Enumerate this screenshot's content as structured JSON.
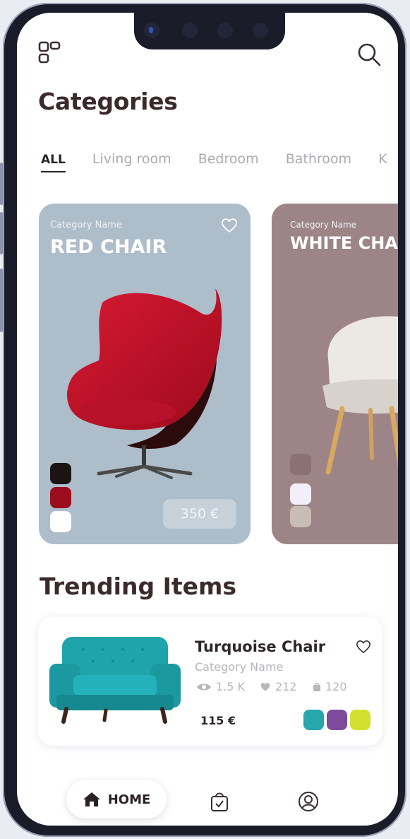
{
  "page": {
    "title": "Categories",
    "trending_title": "Trending Items"
  },
  "tabs": [
    {
      "label": "ALL",
      "active": true
    },
    {
      "label": "Living room",
      "active": false
    },
    {
      "label": "Bedroom",
      "active": false
    },
    {
      "label": "Bathroom",
      "active": false
    },
    {
      "label": "K",
      "active": false
    }
  ],
  "cards": [
    {
      "subtitle": "Category Name",
      "name": "RED CHAIR",
      "price": "350 €",
      "background": "#aebdca",
      "swatches": [
        "#1c1414",
        "#9b0d1d",
        "#ffffff"
      ]
    },
    {
      "subtitle": "Category Name",
      "name": "WHITE CHAI",
      "background": "#9d8587",
      "swatches": [
        "#8b7174",
        "#f3effa",
        "#c9bcb4"
      ]
    }
  ],
  "trending": [
    {
      "name": "Turquoise Chair",
      "category": "Category Name",
      "views": "1.5 K",
      "likes": "212",
      "orders": "120",
      "price": "115 €",
      "swatches": [
        "#26a6ad",
        "#7d4a9c",
        "#d4e030"
      ]
    }
  ],
  "nav": {
    "home_label": "HOME",
    "icons": [
      "home-icon",
      "shopping-bag-icon",
      "profile-icon"
    ]
  },
  "colors": {
    "heading": "#3b2a2c",
    "muted": "#b5b7bd",
    "red_chair": "#c8112a",
    "turquoise": "#1fa4ab"
  }
}
